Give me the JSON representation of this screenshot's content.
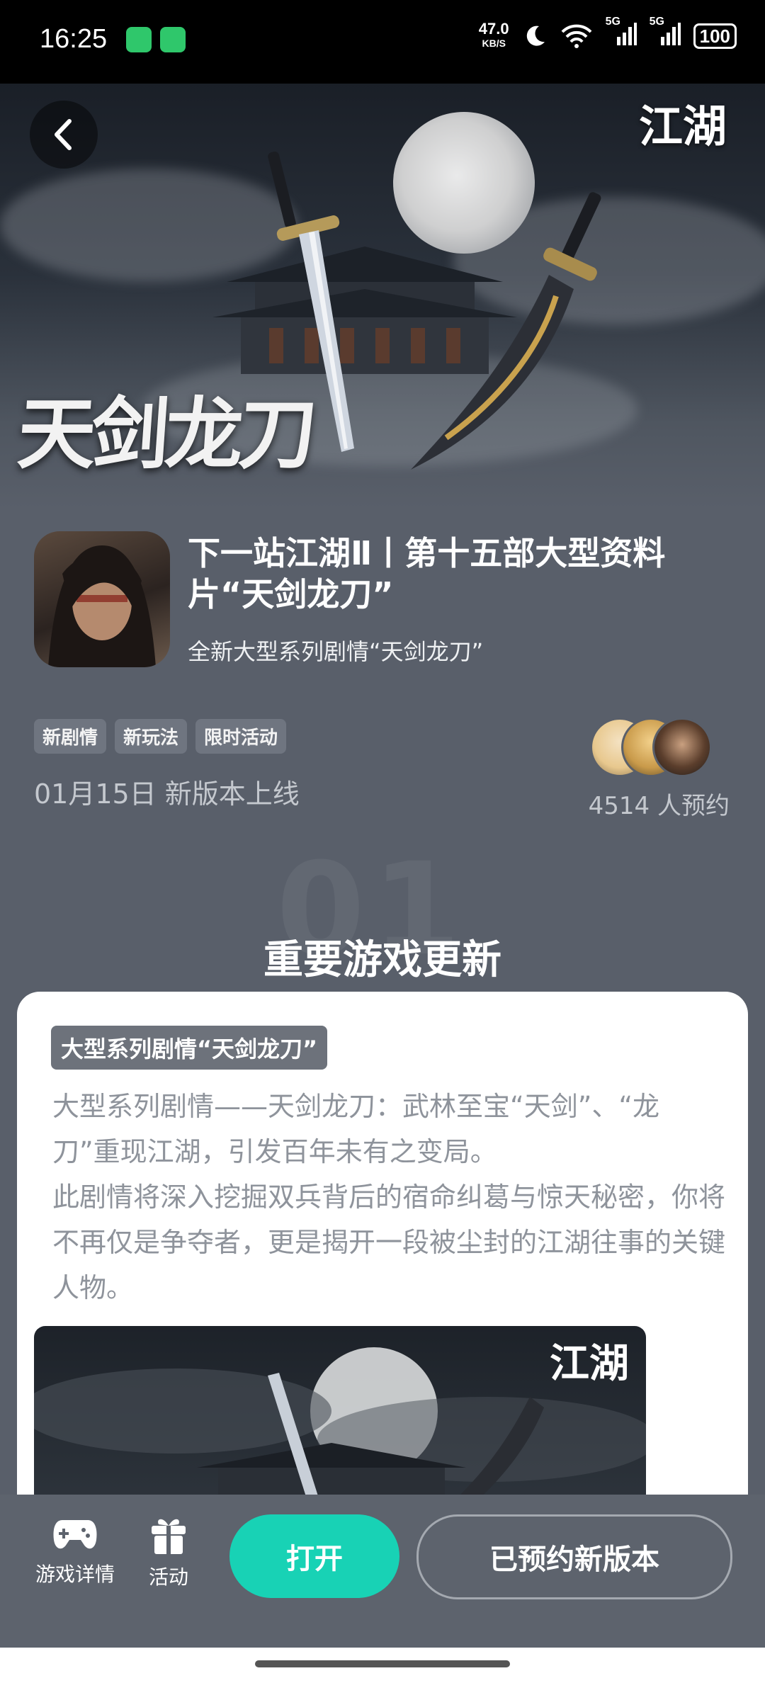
{
  "status_bar": {
    "time": "16:25",
    "net_speed": "47.0",
    "net_unit": "KB/S",
    "signal_1": "5G",
    "signal_2": "5G",
    "battery": "100"
  },
  "hero": {
    "art_title": "天剑龙刀",
    "logo_text": "江湖"
  },
  "game": {
    "title": "下一站江湖Ⅱ丨第十五部大型资料片“天剑龙刀”",
    "subtitle": "全新大型系列剧情“天剑龙刀”",
    "tags": [
      "新剧情",
      "新玩法",
      "限时活动"
    ],
    "release": "01月15日 新版本上线",
    "reservations": "4514 人预约"
  },
  "section": {
    "number": "01",
    "title": "重要游戏更新"
  },
  "card": {
    "tag": "大型系列剧情“天剑龙刀”",
    "para1": "大型系列剧情——天剑龙刀：武林至宝“天剑”、“龙刀”重现江湖，引发百年未有之变局。",
    "para2": "此剧情将深入挖掘双兵背后的宿命纠葛与惊天秘密，你将不再仅是争夺者，更是揭开一段被尘封的江湖往事的关键人物。",
    "image_logo": "江湖"
  },
  "bottom_bar": {
    "details_label": "游戏详情",
    "activity_label": "活动",
    "open_label": "打开",
    "reserved_label": "已预约新版本"
  },
  "colors": {
    "page_bg": "#595f6a",
    "accent": "#18d2b5",
    "card_bg": "#ffffff"
  }
}
